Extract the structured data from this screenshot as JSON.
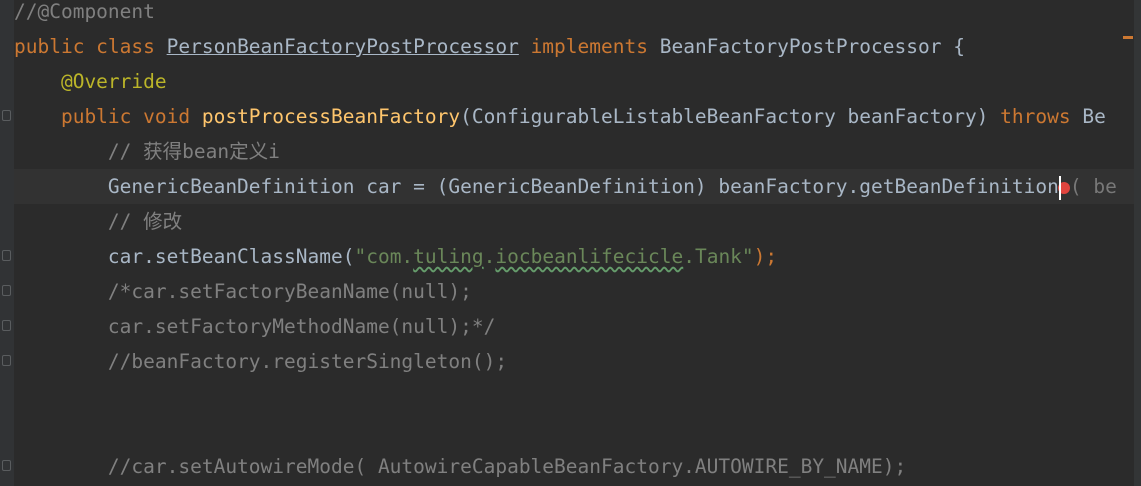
{
  "editor": {
    "lines": [
      {
        "segments": [
          {
            "t": "//@Component",
            "c": "cm"
          }
        ]
      },
      {
        "segments": [
          {
            "t": "public class ",
            "c": "kw"
          },
          {
            "t": "PersonBeanFactoryPostProcessor",
            "c": "cls-u"
          },
          {
            "t": " implements ",
            "c": "kw"
          },
          {
            "t": "BeanFactoryPostProcessor {",
            "c": ""
          }
        ]
      },
      {
        "segments": [
          {
            "t": "    @Override",
            "c": "ann"
          }
        ]
      },
      {
        "segments": [
          {
            "t": "    public void ",
            "c": "kw"
          },
          {
            "t": "postProcessBeanFactory",
            "c": "fn"
          },
          {
            "t": "(ConfigurableListableBeanFactory beanFactory) ",
            "c": ""
          },
          {
            "t": "throws ",
            "c": "kw"
          },
          {
            "t": "Be",
            "c": ""
          }
        ]
      },
      {
        "segments": [
          {
            "t": "        // 获得bean定义i",
            "c": "cm"
          }
        ]
      },
      {
        "current": true,
        "segments": [
          {
            "t": "        GenericBeanDefinition car = (GenericBeanDefinition) beanFactory.getBeanDefinition",
            "c": ""
          },
          {
            "t": "|",
            "c": "caret"
          },
          {
            "t": "( be",
            "c": "hint"
          }
        ]
      },
      {
        "segments": [
          {
            "t": "        // 修改",
            "c": "cm"
          }
        ]
      },
      {
        "segments": [
          {
            "t": "        car.setBeanClassName(",
            "c": ""
          },
          {
            "t": "\"com.",
            "c": "str"
          },
          {
            "t": "tuling",
            "c": "str typo"
          },
          {
            "t": ".",
            "c": "str"
          },
          {
            "t": "iocbeanlifecicle",
            "c": "str typo"
          },
          {
            "t": ".Tank\"",
            "c": "str"
          },
          {
            "t": ");",
            "c": "kw"
          }
        ]
      },
      {
        "segments": [
          {
            "t": "        /*car.setFactoryBeanName(null);",
            "c": "cm"
          }
        ]
      },
      {
        "segments": [
          {
            "t": "        car.setFactoryMethodName(null);*/",
            "c": "cm"
          }
        ]
      },
      {
        "segments": [
          {
            "t": "        //beanFactory.registerSingleton();",
            "c": "cm"
          }
        ]
      },
      {
        "segments": []
      },
      {
        "segments": []
      },
      {
        "segments": [
          {
            "t": "        //car.setAutowireMode( AutowireCapableBeanFactory.AUTOWIRE_BY_NAME);",
            "c": "cm"
          }
        ]
      }
    ]
  },
  "colors": {
    "background": "#2b2b2b",
    "keyword": "#cc7832",
    "annotation": "#bbb529",
    "method": "#ffc66d",
    "comment": "#808080",
    "string": "#6a8759",
    "text": "#a9b7c6"
  }
}
